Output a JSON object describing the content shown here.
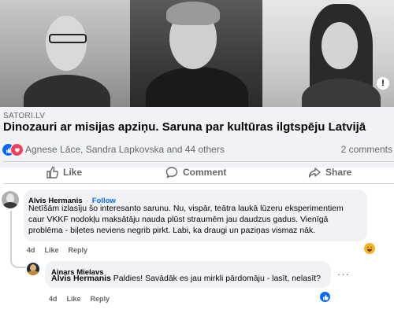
{
  "link": {
    "source": "SATORI.LV",
    "title": "Dinozauri ar misijas apziņu. Saruna par kultūras ilgtspēju Latvijā"
  },
  "reactions": {
    "people": "Agnese Lāce, Sandra Lapkovska and 44 others",
    "comments": "2 comments",
    "icons": [
      "like-icon",
      "heart-icon"
    ]
  },
  "actions": {
    "like": "Like",
    "comment": "Comment",
    "share": "Share"
  },
  "comments": [
    {
      "author": "Alvis Hermanis",
      "separator": "·",
      "follow": "Follow",
      "lines": [
        "Netīšām izlasīju šo interesanto sarunu. Nu, vispār, teātra laukā lūzeru eksperimentiem",
        "caur VKKF nodokļu maksātāju nauda plūst straumēm jau daudzus gadus. Vienīgā",
        "problēma - biļetes neviens negrib pirkt. Labi, ka draugi un paziņas vismaz nāk."
      ],
      "time": "4d",
      "like": "Like",
      "reply": "Reply",
      "reaction_icon": "haha-icon"
    },
    {
      "author": "Ainars Mielavs",
      "mention": "Alvis Hermanis",
      "text": " Paldies! Savādāk es jau mirkli pārdomāju - lasīt, nelasīt?",
      "time": "4d",
      "like": "Like",
      "reply": "Reply",
      "more": "···",
      "reaction_icon": "like-icon"
    }
  ]
}
